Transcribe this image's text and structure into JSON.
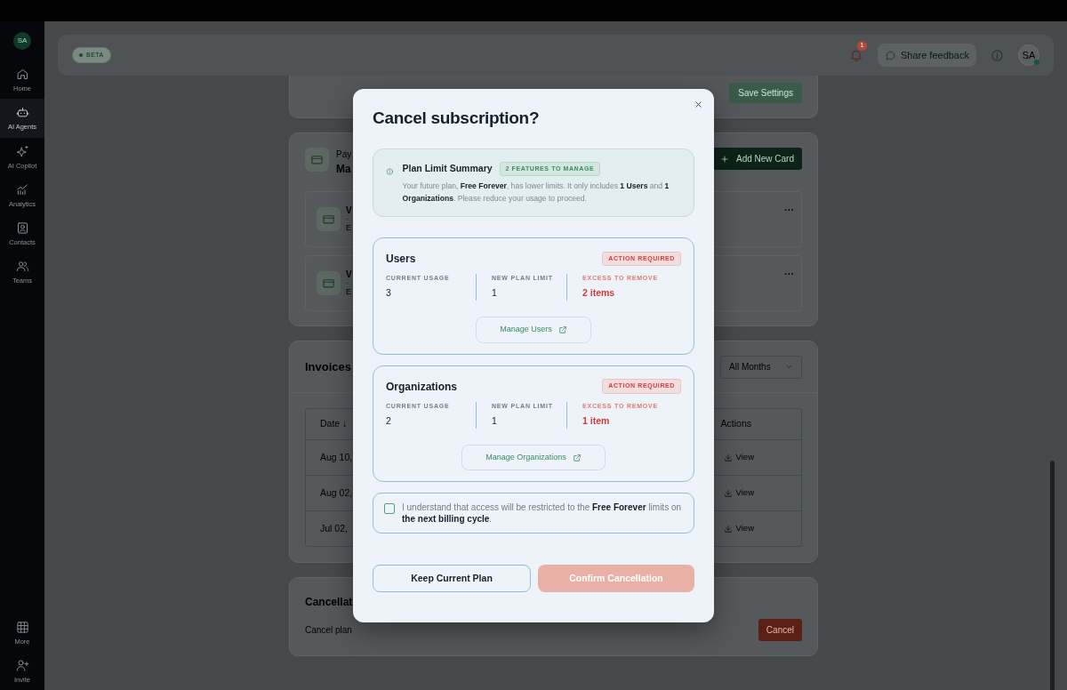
{
  "sidebar": {
    "avatar": "SA",
    "items": [
      {
        "label": "Home",
        "selected": false
      },
      {
        "label": "AI Agents",
        "selected": true
      },
      {
        "label": "AI Copilot",
        "selected": false
      },
      {
        "label": "Analytics",
        "selected": false
      },
      {
        "label": "Contacts",
        "selected": false
      },
      {
        "label": "Teams",
        "selected": false
      }
    ],
    "bottom_items": [
      {
        "label": "More",
        "selected": false
      },
      {
        "label": "Invite",
        "selected": false
      }
    ]
  },
  "header": {
    "badge": "BETA",
    "notification_count": "1",
    "feedback": "Share feedback",
    "avatar": "SA",
    "online": true
  },
  "settings_card": {
    "button": "Save Settings"
  },
  "payment": {
    "eyebrow": "Pay",
    "title": "Ma",
    "add_button": "Add New Card",
    "cards": [
      {
        "title": "V",
        "detail": "·",
        "expiry": "E",
        "menu": "···"
      },
      {
        "title": "V",
        "detail": "·",
        "expiry": "E",
        "menu": "···"
      }
    ]
  },
  "invoices": {
    "title": "Invoices",
    "filter": "All Months",
    "columns": [
      "Date ↓",
      "Actions"
    ],
    "rows": [
      {
        "date": "Aug 10,",
        "action": "View"
      },
      {
        "date": "Aug 02,",
        "action": "View"
      },
      {
        "date": "Jul 02,",
        "action": "View"
      }
    ]
  },
  "cancellation": {
    "title": "Cancellat",
    "subtitle": "Cancel plan",
    "button": "Cancel"
  },
  "modal": {
    "title": "Cancel subscription?",
    "summary": {
      "title": "Plan Limit Summary",
      "badge": "2 FEATURES TO MANAGE",
      "text": "Your future plan, **Free Forever**, has lower limits. It only includes **1 Users** and **1 Organizations**. Please reduce your usage to proceed."
    },
    "features": [
      {
        "name": "Users",
        "badge": "ACTION REQUIRED",
        "stats": [
          {
            "label": "CURRENT USAGE",
            "value": "3",
            "kind": "normal"
          },
          {
            "label": "NEW PLAN LIMIT",
            "value": "1",
            "kind": "normal"
          },
          {
            "label": "EXCESS TO REMOVE",
            "value": "2 items",
            "kind": "excess"
          }
        ],
        "button": "Manage Users"
      },
      {
        "name": "Organizations",
        "badge": "ACTION REQUIRED",
        "stats": [
          {
            "label": "CURRENT USAGE",
            "value": "2",
            "kind": "normal"
          },
          {
            "label": "NEW PLAN LIMIT",
            "value": "1",
            "kind": "normal"
          },
          {
            "label": "EXCESS TO REMOVE",
            "value": "1 item",
            "kind": "excess"
          }
        ],
        "button": "Manage Organizations"
      }
    ],
    "acknowledge": {
      "checked": false,
      "text": "I understand that access will be restricted to the **Free Forever** limits on **the next billing cycle**."
    },
    "keep_button": "Keep Current Plan",
    "confirm_button": {
      "label": "Confirm Cancellation",
      "disabled": true
    }
  }
}
